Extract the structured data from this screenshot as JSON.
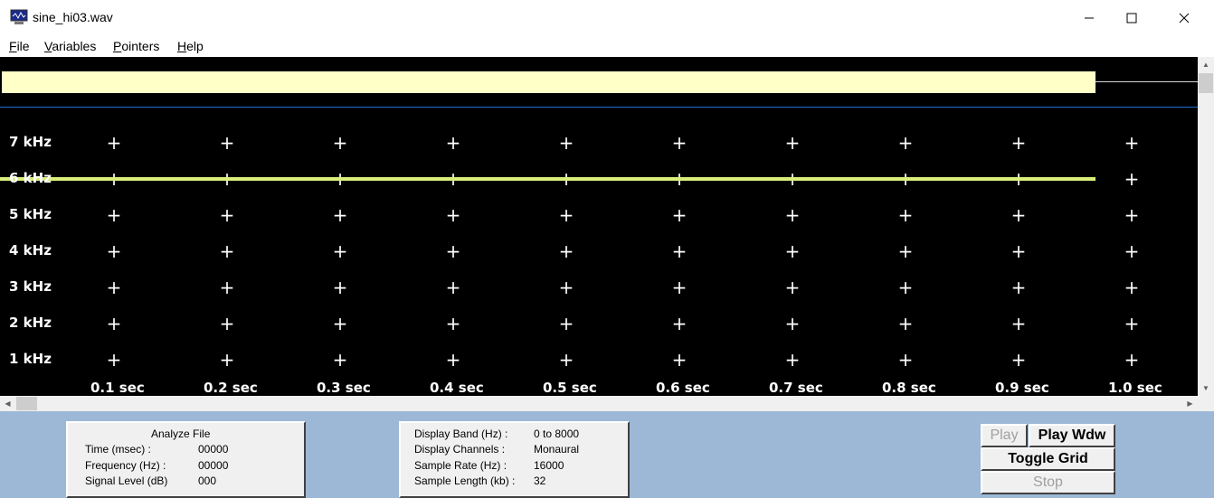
{
  "window": {
    "title": "sine_hi03.wav",
    "controls": [
      "minimize",
      "maximize",
      "close"
    ]
  },
  "menu": [
    {
      "label": "File",
      "mnemonic": "F",
      "rest": "ile"
    },
    {
      "label": "Variables",
      "mnemonic": "V",
      "rest": "ariables"
    },
    {
      "label": "Pointers",
      "mnemonic": "P",
      "rest": "ointers"
    },
    {
      "label": "Help",
      "mnemonic": "H",
      "rest": "elp"
    }
  ],
  "display": {
    "background": "#000000",
    "waveform_color": "#ffffc8",
    "trace_color": "#d8ef7c",
    "trace_frequency": "6 kHz",
    "freq_labels": [
      "7 kHz",
      "6 kHz",
      "5 kHz",
      "4 kHz",
      "3 kHz",
      "2 kHz",
      "1 kHz"
    ],
    "time_labels": [
      "0.1 sec",
      "0.2 sec",
      "0.3 sec",
      "0.4 sec",
      "0.5 sec",
      "0.6 sec",
      "0.7 sec",
      "0.8 sec",
      "0.9 sec",
      "1.0 sec"
    ]
  },
  "analyze_panel": {
    "title": "Analyze File",
    "rows": [
      {
        "label": "Time (msec) :",
        "value": "00000"
      },
      {
        "label": "Frequency (Hz) :",
        "value": "00000"
      },
      {
        "label": "Signal Level (dB)",
        "value": "000"
      }
    ]
  },
  "info_panel": {
    "rows": [
      {
        "label": "Display Band (Hz) :",
        "value": "0 to 8000"
      },
      {
        "label": "Display Channels :",
        "value": "Monaural"
      },
      {
        "label": "Sample Rate (Hz) :",
        "value": "16000"
      },
      {
        "label": "Sample Length (kb) :",
        "value": "32"
      }
    ]
  },
  "buttons": {
    "play": {
      "label": "Play",
      "enabled": false
    },
    "play_wdw": {
      "label": "Play Wdw",
      "enabled": true
    },
    "toggle_grid": {
      "label": "Toggle Grid",
      "enabled": true
    },
    "stop": {
      "label": "Stop",
      "enabled": false
    }
  },
  "colors": {
    "panel_bg": "#9db8d6",
    "separator": "#1e6fd0"
  }
}
